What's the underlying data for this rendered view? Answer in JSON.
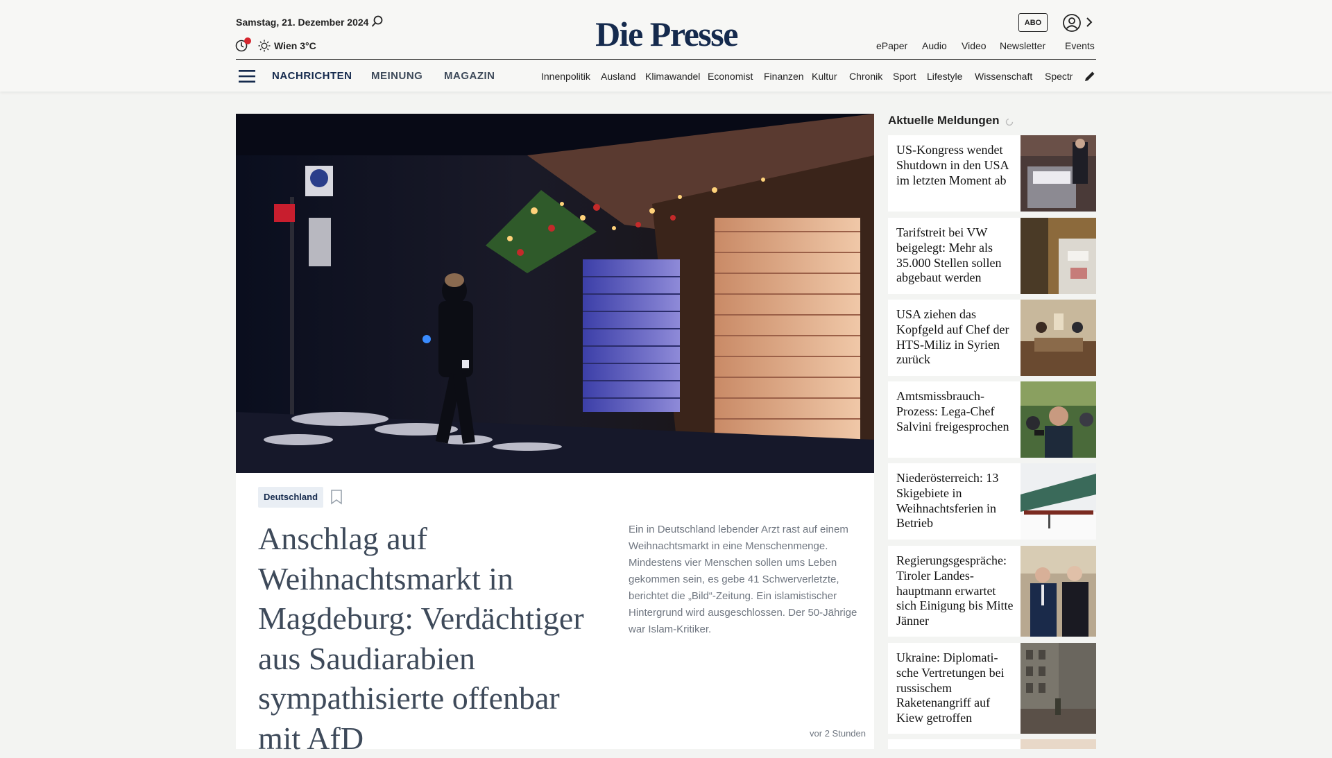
{
  "header": {
    "date": "Samstag, 21. Dezember 2024",
    "weather": "Wien 3°C",
    "logo": "Die Presse",
    "abo_label": "ABO",
    "top_links": [
      "ePaper",
      "Audio",
      "Video",
      "Newsletter",
      "Events"
    ]
  },
  "nav": {
    "main": [
      "NACHRICHTEN",
      "MEINUNG",
      "MAGAZIN"
    ],
    "sub": [
      "Innenpolitik",
      "Ausland",
      "Klimawandel",
      "Economist",
      "Finanzen",
      "Kultur",
      "Chronik",
      "Sport",
      "Lifestyle",
      "Wissenschaft",
      "Spectrum"
    ]
  },
  "feature": {
    "tag": "Deutschland",
    "headline": "Anschlag auf Weihnachtsmarkt in Magdeburg: Verdächti­ger aus Saudiarabien sympathisierte offenbar mit AfD",
    "teaser": "Ein in Deutschland lebender Arzt rast auf einem Weihnachtsmarkt in eine Menschenmenge. Mindestens vier Menschen sollen ums Leben gekommen sein, es gebe 41 Schwerverletzte, berichtet die „Bild“-Zeitung. Ein islamistischer Hintergrund wird ausgeschlossen. Der 50-Jährige war Islam-Kritiker.",
    "time": "vor 2 Stunden"
  },
  "sidebar": {
    "title": "Aktuelle Meldungen",
    "items": [
      {
        "text": "US-Kongress wendet Shutdown in den USA im letzten Moment ab"
      },
      {
        "text": "Tarifstreit bei VW beigelegt: Mehr als 35.000 Stellen sollen abgebaut werden"
      },
      {
        "text": "USA ziehen das Kopfgeld auf Chef der HTS-Miliz in Syrien zurück"
      },
      {
        "text": "Amtsmissbrauch-Prozess: Lega-Chef Salvini freigesprochen"
      },
      {
        "text": "Niederösterreich: 13 Skigebiete in Weihnachtsferien in Betrieb"
      },
      {
        "text": "Regierungsgesprä­che: Tiroler Landes­hauptmann erwartet sich Einigung bis Mitte Jänner"
      },
      {
        "text": "Ukraine: Diplomati­sche Vertretungen bei russischem Raketenangriff auf Kiew getroffen"
      }
    ]
  },
  "colors": {
    "brand_navy": "#152a4d",
    "headline_gray": "#3e4a5a",
    "alert_red": "#d6262e",
    "page_bg": "#f3f4f2"
  }
}
